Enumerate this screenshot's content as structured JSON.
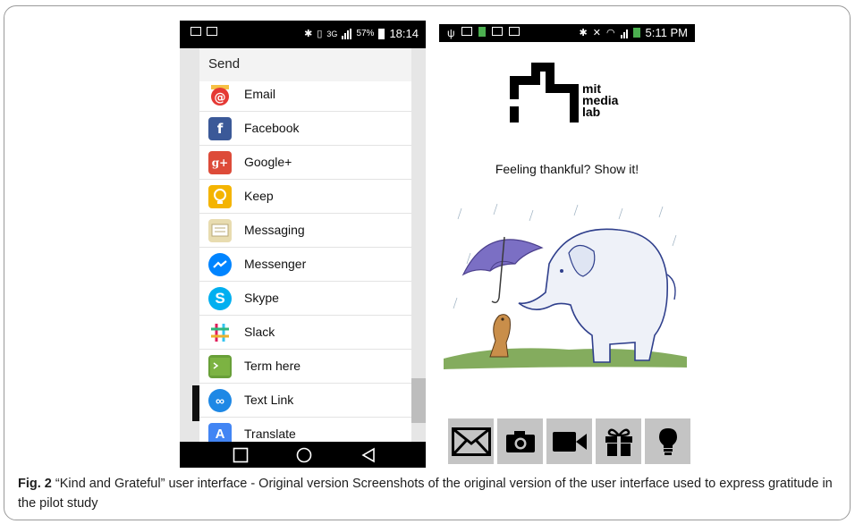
{
  "left_phone": {
    "status": {
      "right_text": "57%",
      "time": "18:14",
      "network": "3G"
    },
    "dialog": {
      "title": "Send",
      "items": [
        {
          "label": "Email",
          "icon": "email-icon",
          "color": "#e53935"
        },
        {
          "label": "Facebook",
          "icon": "facebook-icon",
          "color": "#3b5998"
        },
        {
          "label": "Google+",
          "icon": "google-plus-icon",
          "color": "#dd4b39"
        },
        {
          "label": "Keep",
          "icon": "keep-icon",
          "color": "#f4b400"
        },
        {
          "label": "Messaging",
          "icon": "messaging-icon",
          "color": "#e8dcb0"
        },
        {
          "label": "Messenger",
          "icon": "messenger-icon",
          "color": "#0084ff"
        },
        {
          "label": "Skype",
          "icon": "skype-icon",
          "color": "#00aff0"
        },
        {
          "label": "Slack",
          "icon": "slack-icon",
          "color": "#ffffff"
        },
        {
          "label": "Term here",
          "icon": "terminal-icon",
          "color": "#689f38"
        },
        {
          "label": "Text Link",
          "icon": "link-icon",
          "color": "#1e88e5"
        },
        {
          "label": "Translate",
          "icon": "translate-icon",
          "color": "#4285f4"
        }
      ]
    }
  },
  "right_phone": {
    "status": {
      "time": "5:11 PM"
    },
    "logo_lines": [
      "mit",
      "media",
      "lab"
    ],
    "tagline": "Feeling thankful? Show it!",
    "action_buttons": [
      "envelope-icon",
      "camera-icon",
      "video-icon",
      "gift-icon",
      "lightbulb-icon"
    ]
  },
  "caption": {
    "label": "Fig. 2",
    "text": " “Kind and Grateful” user interface - Original version Screenshots of the original version of the user interface used to express gratitude in the pilot study"
  }
}
